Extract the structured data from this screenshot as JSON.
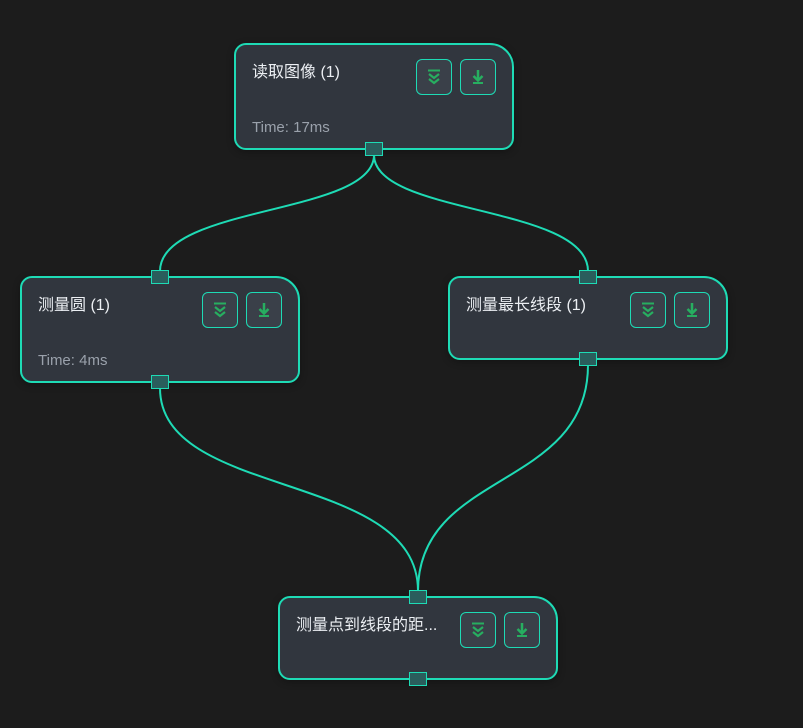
{
  "nodes": {
    "readImage": {
      "title": "读取图像 (1)",
      "time": "Time: 17ms"
    },
    "measureCircle": {
      "title": "测量圆 (1)",
      "time": "Time: 4ms"
    },
    "measureLongestSegment": {
      "title": "测量最长线段 (1)"
    },
    "measurePointToSegment": {
      "title": "测量点到线段的距..."
    }
  },
  "colors": {
    "accent": "#1edbb5",
    "iconGreen": "#27ae60",
    "nodeBg": "#31363e",
    "bg": "#1c1c1c"
  },
  "icons": {
    "expand": "expand-double-chevron-icon",
    "download": "download-arrow-icon"
  }
}
